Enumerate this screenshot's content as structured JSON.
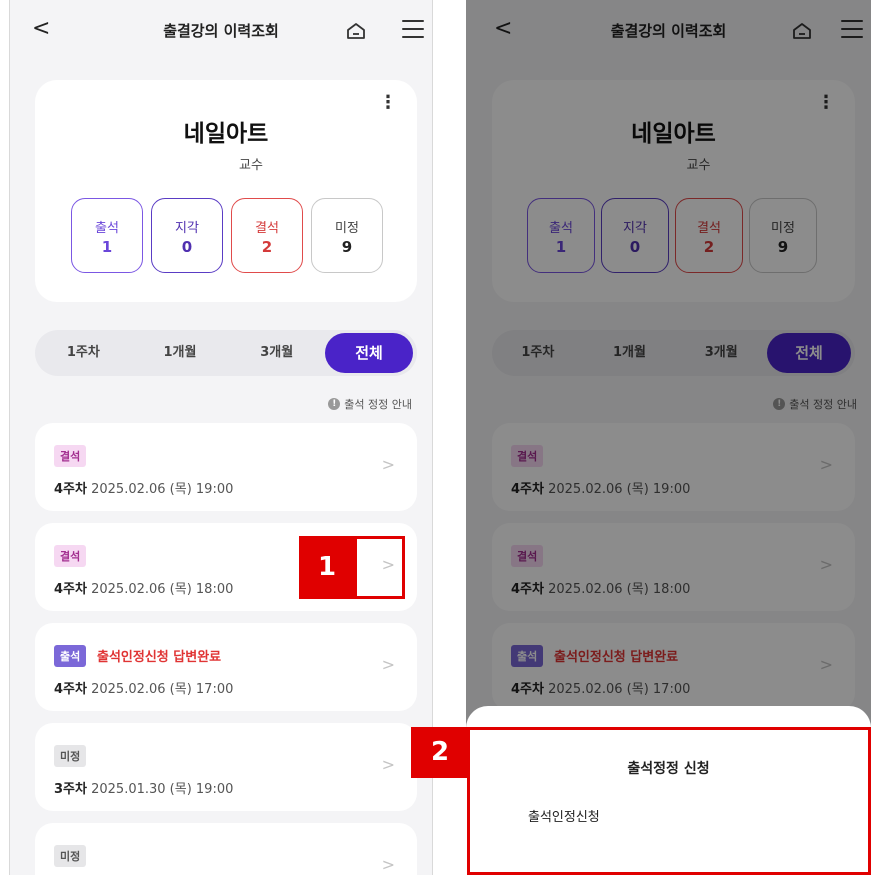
{
  "header": {
    "back_label": "<",
    "title": "출결강의 이력조회"
  },
  "profile": {
    "name": "네일아트",
    "role": "교수",
    "menu_label": "⋮"
  },
  "stats": [
    {
      "label": "출석",
      "value": "1"
    },
    {
      "label": "지각",
      "value": "0"
    },
    {
      "label": "결석",
      "value": "2"
    },
    {
      "label": "미정",
      "value": "9"
    }
  ],
  "tabs": [
    "1주차",
    "1개월",
    "3개월",
    "전체"
  ],
  "active_tab": "전체",
  "notice": {
    "icon": "info-icon",
    "text": "출석 정정 안내"
  },
  "records": [
    {
      "badge": "결석",
      "extra": "",
      "week": "4주차",
      "datetime": "2025.02.06 (목) 19:00"
    },
    {
      "badge": "결석",
      "extra": "",
      "week": "4주차",
      "datetime": "2025.02.06 (목) 18:00"
    },
    {
      "badge": "출석",
      "extra": "출석인정신청 답변완료",
      "week": "4주차",
      "datetime": "2025.02.06 (목) 17:00"
    },
    {
      "badge": "미정",
      "extra": "",
      "week": "3주차",
      "datetime": "2025.01.30 (목) 19:00"
    },
    {
      "badge": "미정",
      "extra": "",
      "week": "",
      "datetime": ""
    }
  ],
  "chevron": ">",
  "sheet": {
    "title": "출석정정 신청",
    "option": "출석인정신청"
  },
  "markers": {
    "one": "1",
    "two": "2"
  },
  "colors": {
    "accent": "#4a23c8",
    "absent": "#e04b4b",
    "marker": "#e00000"
  }
}
